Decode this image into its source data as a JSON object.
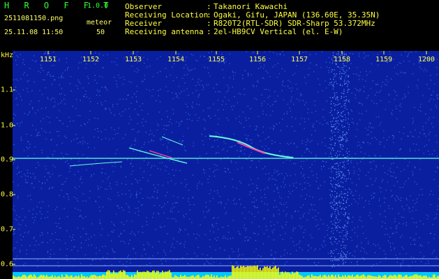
{
  "header": {
    "app_title": "H R O F F T",
    "app_version": "1.0.0",
    "file_name": "2511081150.png",
    "event_type": "meteor",
    "date_time": "25.11.08 11:50",
    "count": "50",
    "info": [
      {
        "label": "Observer",
        "value": "Takanori Kawachi"
      },
      {
        "label": "Receiving Location",
        "value": "Ogaki, Gifu, JAPAN (136.60E, 35.35N)"
      },
      {
        "label": "Receiver",
        "value": "R820T2(RTL-SDR) SDR-Sharp 53.372MHz"
      },
      {
        "label": "Receiving antenna",
        "value": "2el-HB9CV Vertical (el. E-W)"
      }
    ]
  },
  "colors": {
    "background": "#0a1fa0",
    "noise": "#3a78ff",
    "carrier": "#66ffdd",
    "echo_hot": "#ff44aa",
    "level_bar": "#ffff00",
    "level_base": "#00c8ff",
    "label": "#ffff44"
  },
  "chart_data": {
    "type": "heatmap",
    "axis_unit": "kHz",
    "x_ticks": [
      "1151",
      "1152",
      "1153",
      "1154",
      "1155",
      "1156",
      "1157",
      "1158",
      "1159",
      "1200"
    ],
    "y_ticks": [
      "1.1",
      "1.0",
      "0.9",
      "0.8",
      "0.7",
      "0.6"
    ],
    "y_range": [
      0.6,
      1.1
    ]
  }
}
